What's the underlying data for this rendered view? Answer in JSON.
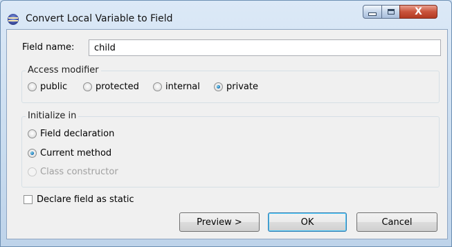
{
  "window": {
    "title": "Convert Local Variable to Field",
    "close_glyph": "X"
  },
  "field": {
    "label": "Field name:",
    "value": "child"
  },
  "access": {
    "title": "Access modifier",
    "options": [
      {
        "label": "public",
        "selected": false
      },
      {
        "label": "protected",
        "selected": false
      },
      {
        "label": "internal",
        "selected": false
      },
      {
        "label": "private",
        "selected": true
      }
    ]
  },
  "initialize": {
    "title": "Initialize in",
    "options": [
      {
        "label": "Field declaration",
        "selected": false,
        "enabled": true
      },
      {
        "label": "Current method",
        "selected": true,
        "enabled": true
      },
      {
        "label": "Class constructor",
        "selected": false,
        "enabled": false
      }
    ]
  },
  "static_checkbox": {
    "label": "Declare field as static",
    "checked": false
  },
  "buttons": {
    "preview": "Preview >",
    "ok": "OK",
    "cancel": "Cancel"
  },
  "icons": {
    "app": "eclipse-icon",
    "minimize": "minimize-icon",
    "maximize": "maximize-icon",
    "close": "close-icon"
  }
}
